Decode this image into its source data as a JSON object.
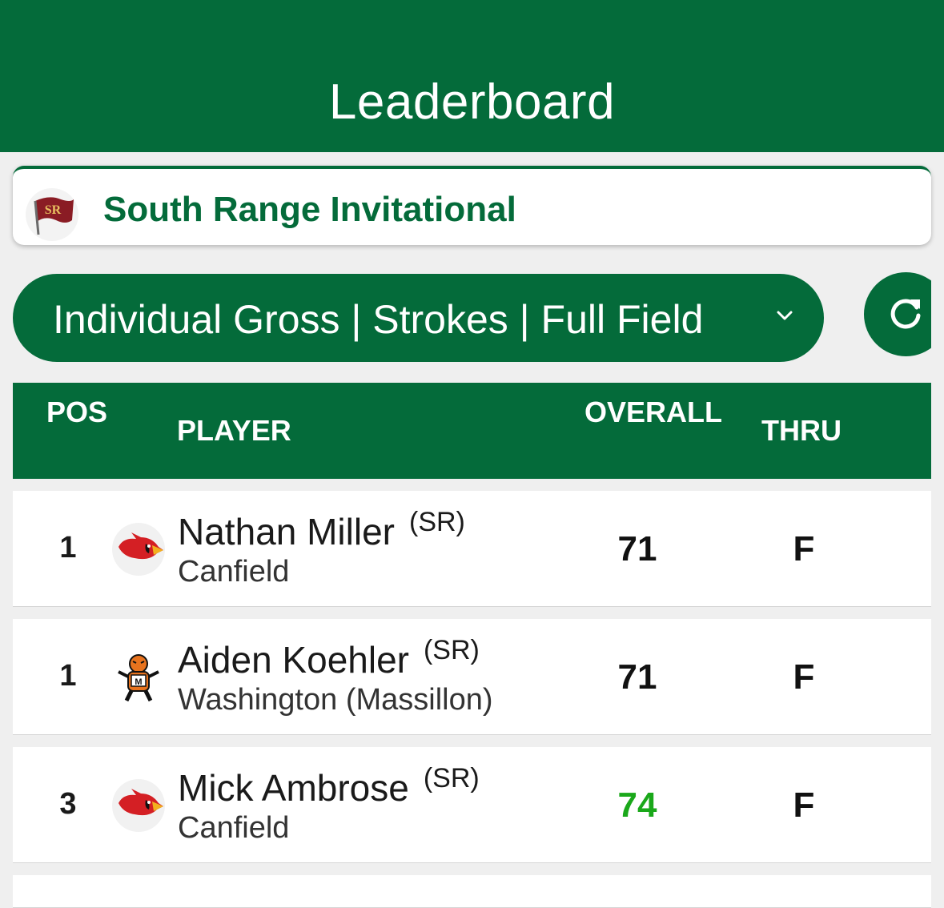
{
  "header": {
    "title": "Leaderboard"
  },
  "event": {
    "name": "South Range Invitational",
    "logo_icon": "south-range-flag-logo",
    "logo_text": "SR"
  },
  "filter": {
    "selected": "Individual Gross | Strokes | Full Field",
    "icon": "chevron-down-icon"
  },
  "refresh": {
    "icon": "refresh-icon"
  },
  "table": {
    "columns": {
      "pos": "POS",
      "player": "PLAYER",
      "overall": "OVERALL",
      "thru": "THRU"
    },
    "rows": [
      {
        "pos": "1",
        "name": "Nathan Miller",
        "class": "(SR)",
        "school": "Canfield",
        "overall": "71",
        "thru": "F",
        "logo": "cardinal-logo",
        "highlight": false
      },
      {
        "pos": "1",
        "name": "Aiden Koehler",
        "class": "(SR)",
        "school": "Washington (Massillon)",
        "overall": "71",
        "thru": "F",
        "logo": "tiger-logo",
        "highlight": false
      },
      {
        "pos": "3",
        "name": "Mick Ambrose",
        "class": "(SR)",
        "school": "Canfield",
        "overall": "74",
        "thru": "F",
        "logo": "cardinal-logo",
        "highlight": true
      }
    ]
  },
  "colors": {
    "brand": "#046b3a",
    "score_highlight": "#1aa81a"
  }
}
